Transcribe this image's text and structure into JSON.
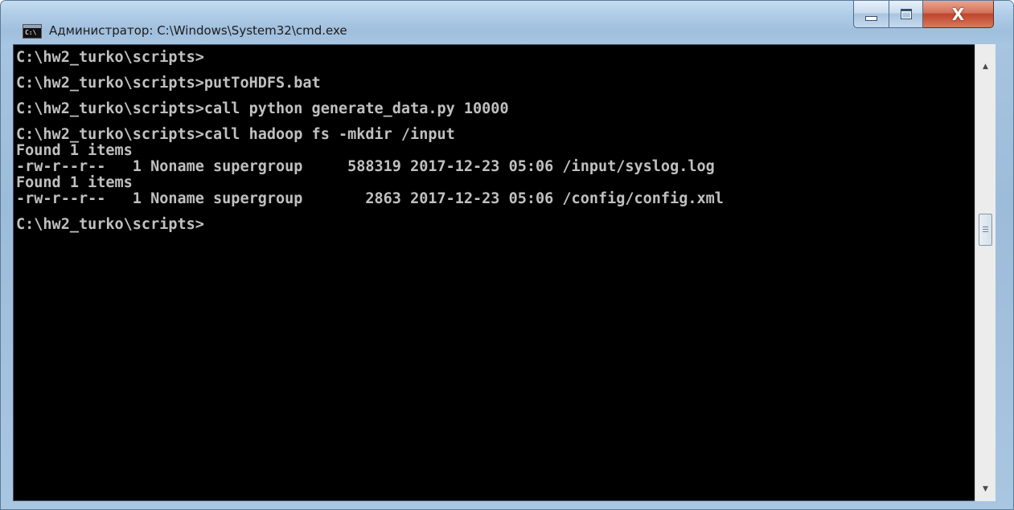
{
  "window": {
    "title": "Администратор: C:\\Windows\\System32\\cmd.exe",
    "icon_text": "C:\\",
    "icon": "console-icon",
    "buttons": {
      "minimize": "minimize-icon",
      "maximize": "maximize-icon",
      "close": "close-icon"
    },
    "close_glyph": "X"
  },
  "console": {
    "lines": [
      "C:\\hw2_turko\\scripts>",
      "",
      "C:\\hw2_turko\\scripts>putToHDFS.bat",
      "",
      "C:\\hw2_turko\\scripts>call python generate_data.py 10000",
      "",
      "C:\\hw2_turko\\scripts>call hadoop fs -mkdir /input",
      "Found 1 items",
      "-rw-r--r--   1 Noname supergroup     588319 2017-12-23 05:06 /input/syslog.log",
      "Found 1 items",
      "-rw-r--r--   1 Noname supergroup       2863 2017-12-23 05:06 /config/config.xml",
      "",
      "C:\\hw2_turko\\scripts>"
    ],
    "background": "#000000",
    "foreground": "#c0c0c0"
  },
  "scrollbar": {
    "up_icon": "scroll-up-arrow-icon",
    "down_icon": "scroll-down-arrow-icon",
    "thumb": "scroll-thumb"
  }
}
